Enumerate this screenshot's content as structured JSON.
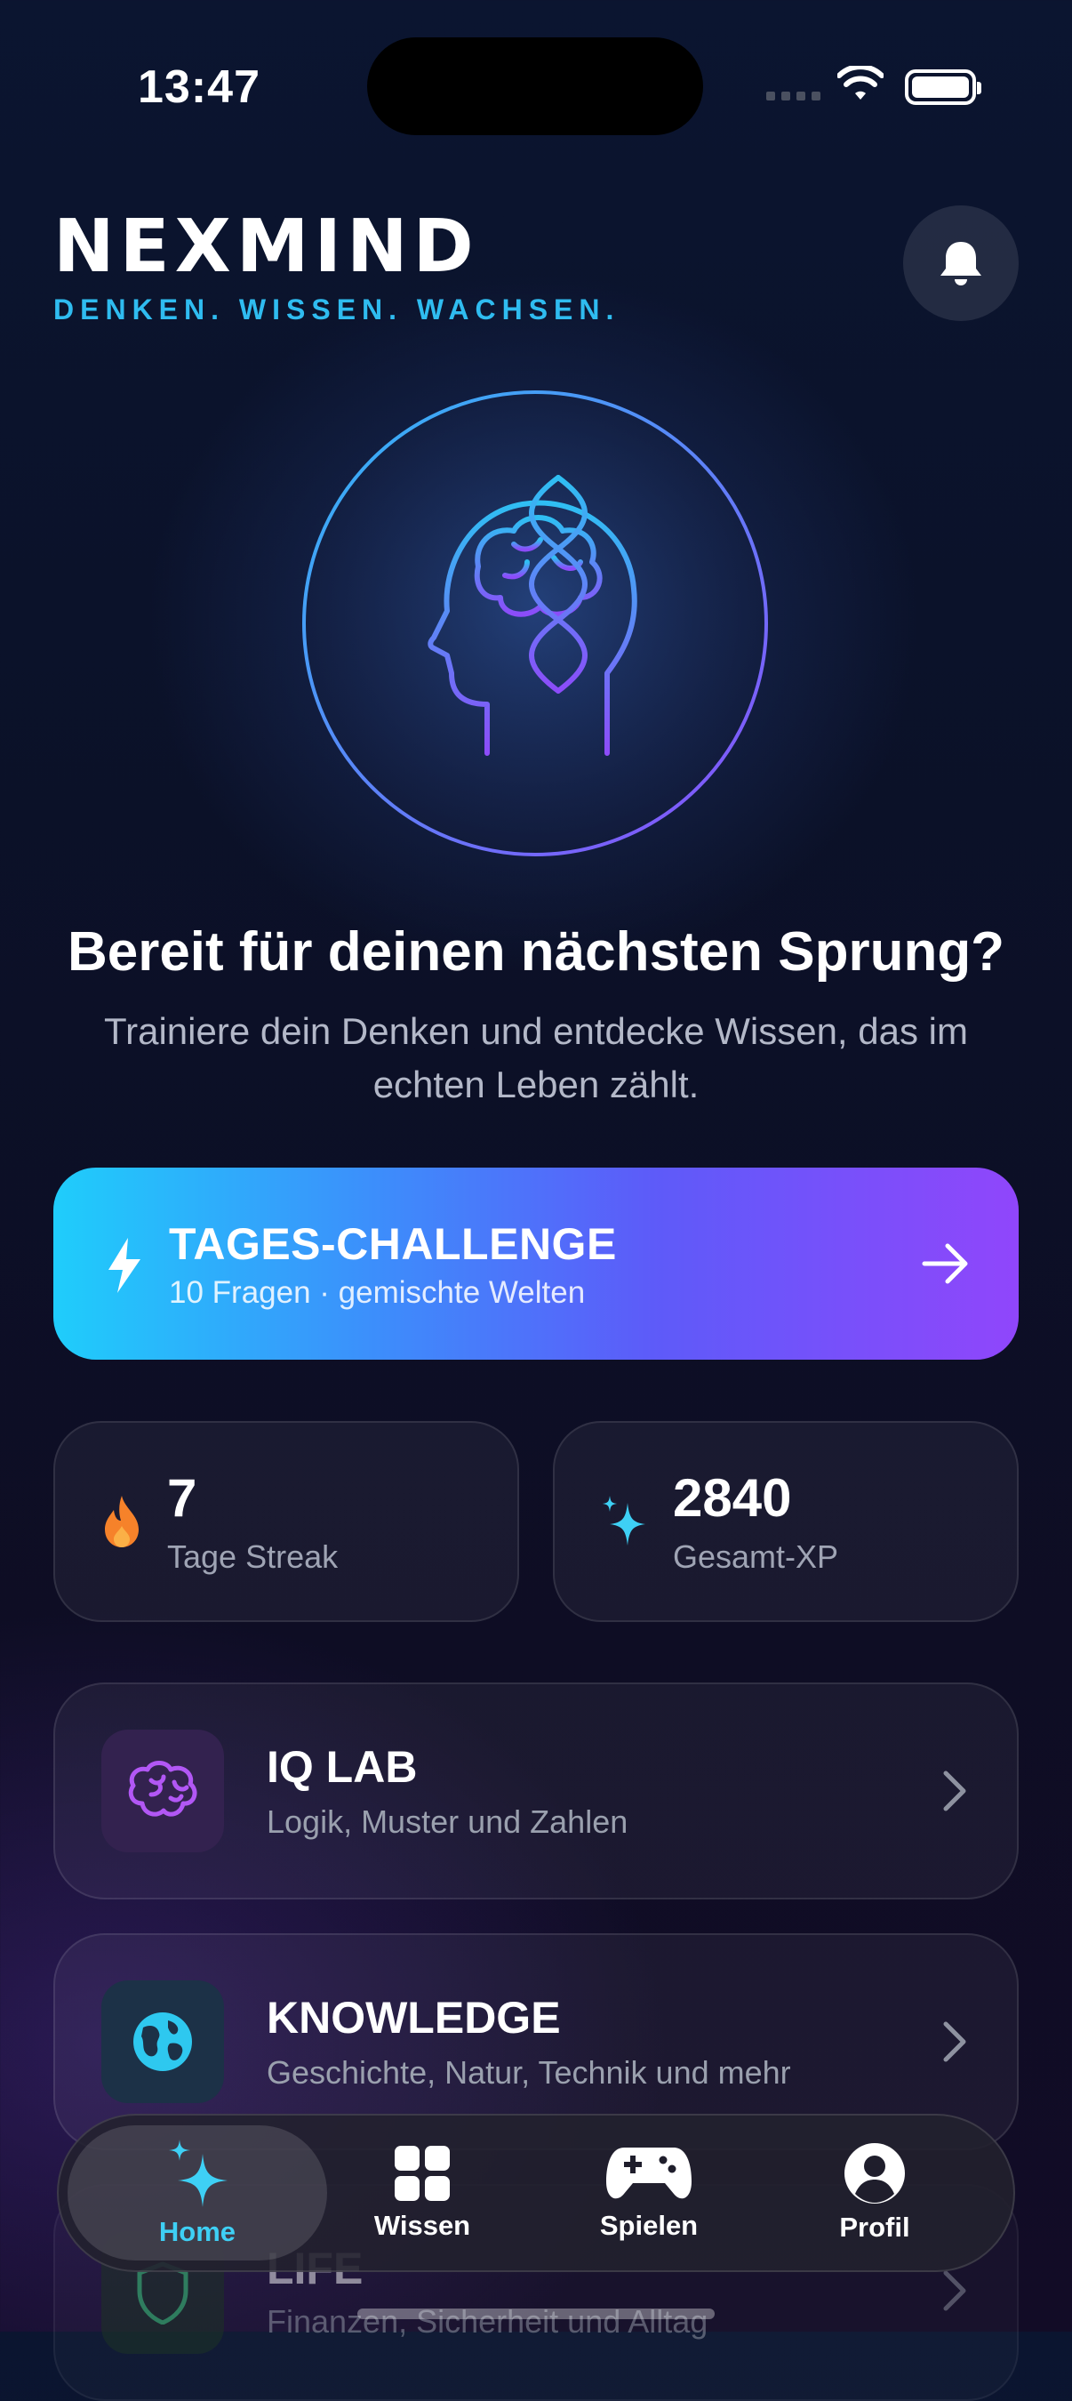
{
  "status": {
    "time": "13:47"
  },
  "header": {
    "brand": "NEXMIND",
    "tagline": "DENKEN. WISSEN. WACHSEN."
  },
  "hero": {
    "headline": "Bereit für deinen nächsten Sprung?",
    "subline": "Trainiere dein Denken und entdecke Wissen, das im echten Leben zählt."
  },
  "challenge": {
    "title": "TAGES-CHALLENGE",
    "subtitle": "10 Fragen · gemischte Welten"
  },
  "stats": {
    "streak": {
      "value": "7",
      "label": "Tage Streak"
    },
    "xp": {
      "value": "2840",
      "label": "Gesamt-XP"
    }
  },
  "cards": [
    {
      "title": "IQ LAB",
      "subtitle": "Logik, Muster und Zahlen",
      "icon": "brain-icon"
    },
    {
      "title": "KNOWLEDGE",
      "subtitle": "Geschichte, Natur, Technik und mehr",
      "icon": "globe-icon"
    },
    {
      "title": "LIFE",
      "subtitle": "Finanzen, Sicherheit und Alltag",
      "icon": "shield-icon"
    }
  ],
  "tabs": [
    {
      "label": "Home",
      "icon": "sparkles-icon",
      "active": true
    },
    {
      "label": "Wissen",
      "icon": "grid-icon"
    },
    {
      "label": "Spielen",
      "icon": "gamepad-icon"
    },
    {
      "label": "Profil",
      "icon": "person-icon"
    }
  ],
  "colors": {
    "accent_cyan": "#2fbcf0",
    "accent_purple": "#9046fb",
    "streak_orange": "#f6822a"
  }
}
